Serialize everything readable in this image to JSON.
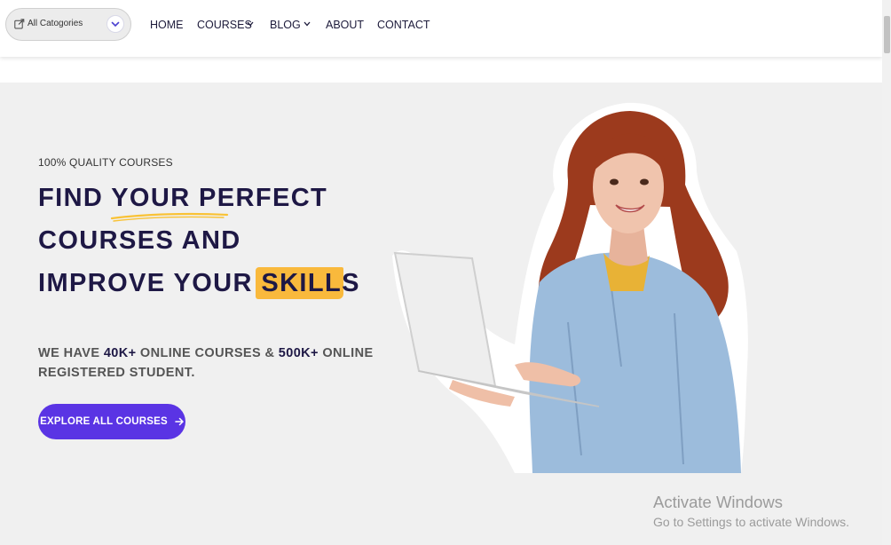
{
  "header": {
    "category_select": {
      "label": "All Catogories",
      "icon": "share-square-icon"
    },
    "nav": [
      {
        "label": "HOME",
        "has_dropdown": false
      },
      {
        "label": "COURSES",
        "has_dropdown": true
      },
      {
        "label": "BLOG",
        "has_dropdown": true
      },
      {
        "label": "ABOUT",
        "has_dropdown": false
      },
      {
        "label": "CONTACT",
        "has_dropdown": false
      }
    ]
  },
  "hero": {
    "eyebrow": "100% QUALITY COURSES",
    "headline": {
      "line1": "FIND YOUR PERFECT",
      "line2": "COURSES AND",
      "line3_prefix": "IMPROVE YOUR ",
      "line3_highlight": "SKILLS"
    },
    "subtext": {
      "part1": "WE HAVE ",
      "courses_count": "40K+",
      "part2": " ONLINE COURSES & ",
      "students_count": "500K+",
      "part3": " ONLINE",
      "line2": "REGISTERED STUDENT."
    },
    "cta_label": "EXPLORE ALL COURSES"
  },
  "watermark": {
    "title": "Activate Windows",
    "subtitle": "Go to Settings to activate Windows."
  },
  "colors": {
    "primary": "#5a34e4",
    "heading": "#1e1845",
    "highlight": "#f9b93c",
    "hero_bg": "#f0f0f0"
  }
}
